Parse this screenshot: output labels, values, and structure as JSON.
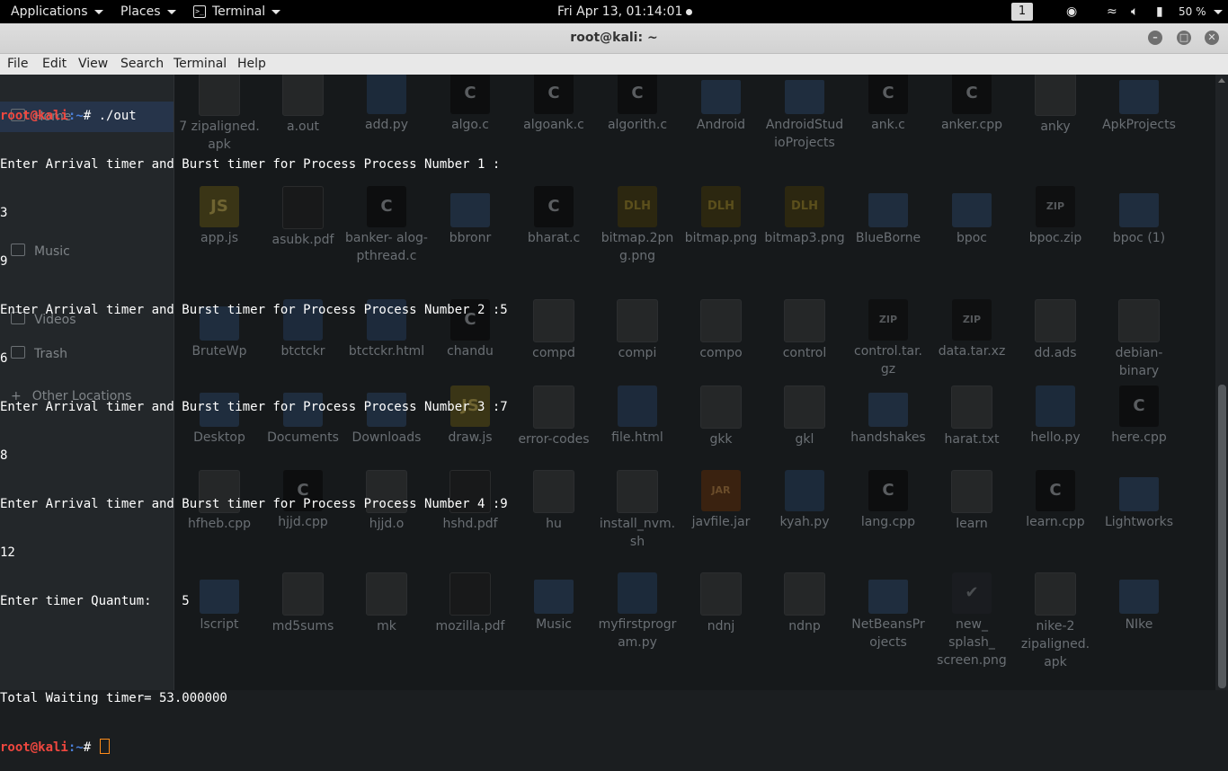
{
  "topbar": {
    "applications": "Applications",
    "places": "Places",
    "terminal": "Terminal",
    "clock": "Fri Apr 13, 01:14:01",
    "workspace": "1",
    "battery": "50 %"
  },
  "window": {
    "title": "root@kali: ~",
    "menu": [
      "File",
      "Edit",
      "View",
      "Search",
      "Terminal",
      "Help"
    ]
  },
  "terminal": {
    "prompt_user": "root@kali",
    "prompt_path": ":~",
    "prompt_suffix": "# ",
    "command": "./out",
    "output": [
      "Enter Arrival timer and Burst timer for Process Process Number 1 :",
      "3",
      "9",
      "Enter Arrival timer and Burst timer for Process Process Number 2 :5",
      "6",
      "Enter Arrival timer and Burst timer for Process Process Number 3 :7",
      "8",
      "Enter Arrival timer and Burst timer for Process Process Number 4 :9",
      "12",
      "Enter timer Quantum:    5",
      "",
      "Total Waiting timer= 53.000000"
    ]
  },
  "file_manager": {
    "sidebar": [
      "Home",
      "Music",
      "Videos",
      "Trash",
      "Other Locations"
    ],
    "files": [
      {
        "name": "7 zipaligned. apk",
        "icon": "doc"
      },
      {
        "name": "a.out",
        "icon": "doc"
      },
      {
        "name": "add.py",
        "icon": "py"
      },
      {
        "name": "algo.c",
        "icon": "dark"
      },
      {
        "name": "algoank.c",
        "icon": "dark"
      },
      {
        "name": "algorith.c",
        "icon": "dark"
      },
      {
        "name": "Android",
        "icon": "folder"
      },
      {
        "name": "AndroidStud ioProjects",
        "icon": "folder"
      },
      {
        "name": "ank.c",
        "icon": "dark"
      },
      {
        "name": "anker.cpp",
        "icon": "dark"
      },
      {
        "name": "anky",
        "icon": "doc"
      },
      {
        "name": "ApkProjects",
        "icon": "folder"
      },
      {
        "name": "app.js",
        "icon": "js"
      },
      {
        "name": "asubk.pdf",
        "icon": "pdf"
      },
      {
        "name": "banker- alog- pthread.c",
        "icon": "dark"
      },
      {
        "name": "bbronr",
        "icon": "folder"
      },
      {
        "name": "bharat.c",
        "icon": "dark"
      },
      {
        "name": "bitmap.2pn g.png",
        "icon": "img"
      },
      {
        "name": "bitmap.png",
        "icon": "img"
      },
      {
        "name": "bitmap3.png",
        "icon": "img"
      },
      {
        "name": "BlueBorne",
        "icon": "folder"
      },
      {
        "name": "bpoc",
        "icon": "folder"
      },
      {
        "name": "bpoc.zip",
        "icon": "archive"
      },
      {
        "name": "bpoc (1)",
        "icon": "folder"
      },
      {
        "name": "BruteWp",
        "icon": "folder"
      },
      {
        "name": "btctckr",
        "icon": "html"
      },
      {
        "name": "btctckr.html",
        "icon": "html"
      },
      {
        "name": "chandu",
        "icon": "dark"
      },
      {
        "name": "compd",
        "icon": "doc"
      },
      {
        "name": "compi",
        "icon": "doc"
      },
      {
        "name": "compo",
        "icon": "doc"
      },
      {
        "name": "control",
        "icon": "doc"
      },
      {
        "name": "control.tar. gz",
        "icon": "archive"
      },
      {
        "name": "data.tar.xz",
        "icon": "archive"
      },
      {
        "name": "dd.ads",
        "icon": "doc"
      },
      {
        "name": "debian- binary",
        "icon": "doc"
      },
      {
        "name": "Desktop",
        "icon": "folder"
      },
      {
        "name": "Documents",
        "icon": "folder"
      },
      {
        "name": "Downloads",
        "icon": "folder"
      },
      {
        "name": "draw.js",
        "icon": "js"
      },
      {
        "name": "error-codes",
        "icon": "doc"
      },
      {
        "name": "file.html",
        "icon": "html"
      },
      {
        "name": "gkk",
        "icon": "doc"
      },
      {
        "name": "gkl",
        "icon": "doc"
      },
      {
        "name": "handshakes",
        "icon": "folder"
      },
      {
        "name": "harat.txt",
        "icon": "doc"
      },
      {
        "name": "hello.py",
        "icon": "py"
      },
      {
        "name": "here.cpp",
        "icon": "dark"
      },
      {
        "name": "hfheb.cpp",
        "icon": "doc"
      },
      {
        "name": "hjjd.cpp",
        "icon": "dark"
      },
      {
        "name": "hjjd.o",
        "icon": "doc"
      },
      {
        "name": "hshd.pdf",
        "icon": "pdf"
      },
      {
        "name": "hu",
        "icon": "doc"
      },
      {
        "name": "install_nvm. sh",
        "icon": "doc"
      },
      {
        "name": "javfile.jar",
        "icon": "jar"
      },
      {
        "name": "kyah.py",
        "icon": "py"
      },
      {
        "name": "lang.cpp",
        "icon": "dark"
      },
      {
        "name": "learn",
        "icon": "doc"
      },
      {
        "name": "learn.cpp",
        "icon": "dark"
      },
      {
        "name": "Lightworks",
        "icon": "folder"
      },
      {
        "name": "lscript",
        "icon": "folder"
      },
      {
        "name": "md5sums",
        "icon": "doc"
      },
      {
        "name": "mk",
        "icon": "doc"
      },
      {
        "name": "mozilla.pdf",
        "icon": "pdf"
      },
      {
        "name": "Music",
        "icon": "folder"
      },
      {
        "name": "myfirstprogr am.py",
        "icon": "py"
      },
      {
        "name": "ndnj",
        "icon": "doc"
      },
      {
        "name": "ndnp",
        "icon": "doc"
      },
      {
        "name": "NetBeansPr ojects",
        "icon": "folder"
      },
      {
        "name": "new_ splash_ screen.png",
        "icon": "nike"
      },
      {
        "name": "nike-2 zipaligned. apk",
        "icon": "doc"
      },
      {
        "name": "NIke",
        "icon": "folder"
      }
    ]
  }
}
